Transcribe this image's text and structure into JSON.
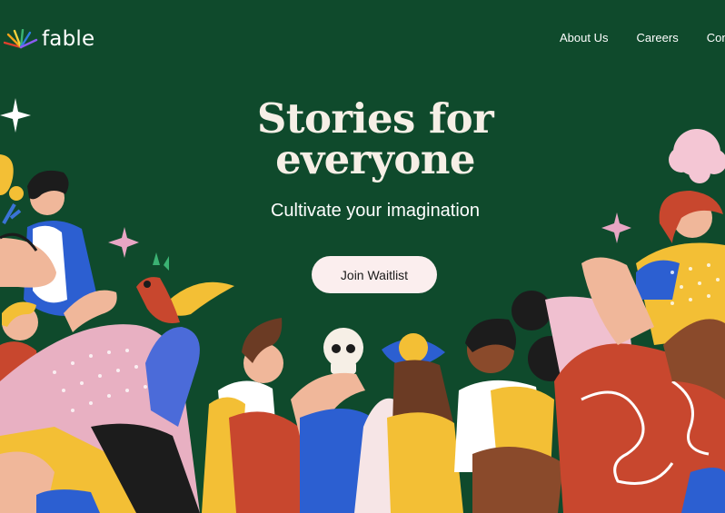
{
  "brand": {
    "name": "fable"
  },
  "nav": {
    "links": [
      "About Us",
      "Careers",
      "Con"
    ]
  },
  "hero": {
    "headline_line1": "Stories for",
    "headline_line2": "everyone",
    "subheadline": "Cultivate your imagination",
    "cta_label": "Join Waitlist"
  },
  "colors": {
    "background": "#0f4a2c",
    "headline": "#f6efe6",
    "cta_background": "#fbeeee",
    "illustration_red": "#c8472e",
    "illustration_yellow": "#f3bf35",
    "illustration_blue": "#2c5fd1",
    "illustration_pink": "#e8b0c2"
  }
}
